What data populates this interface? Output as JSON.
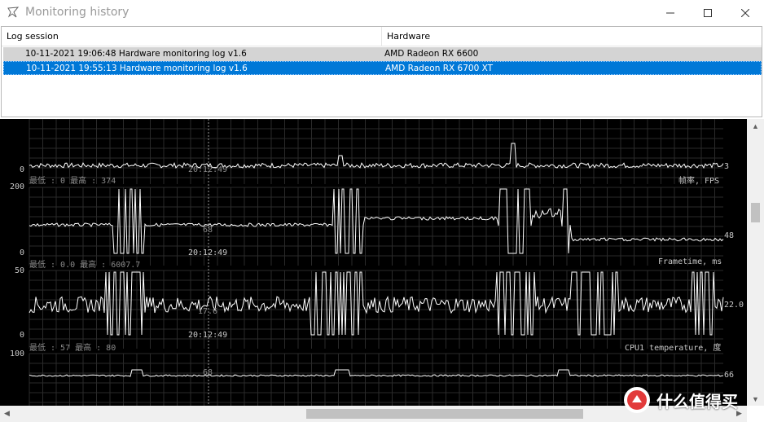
{
  "window": {
    "title": "Monitoring history",
    "icons": {
      "app": "afterburner-plane-icon",
      "minimize": "minimize-icon",
      "maximize": "maximize-icon",
      "close": "close-icon"
    }
  },
  "listview": {
    "columns": [
      "Log session",
      "Hardware"
    ],
    "rows": [
      {
        "session": "10-11-2021 19:06:48 Hardware monitoring log v1.6",
        "hardware": "AMD Radeon RX 6600",
        "selected": false
      },
      {
        "session": "10-11-2021 19:55:13 Hardware monitoring log v1.6",
        "hardware": "AMD Radeon RX 6700 XT",
        "selected": true
      }
    ]
  },
  "graphs": {
    "fps": {
      "axis_min": "0",
      "cursor_time": "20:12:49",
      "stats": "最低 : 0  最高 : 374",
      "name": "帧率, FPS",
      "current": "3"
    },
    "frametime": {
      "axis_max": "200",
      "axis_min": "0",
      "cursor_value": "68",
      "cursor_time": "20:12:49",
      "stats": "最低 : 0.0  最高 : 6007.7",
      "name": "Frametime, ms",
      "current": "48"
    },
    "cpu_temp": {
      "axis_max": "50",
      "axis_min": "0",
      "cursor_value": "17.6",
      "cursor_time": "20:12:49",
      "stats": "最低 : 57  最高 : 80",
      "name": "CPU1 temperature, 度",
      "current": "22.0"
    },
    "next": {
      "axis_max": "100",
      "cursor_value": "68",
      "current": "66"
    }
  },
  "watermark": {
    "text": "什么值得买",
    "badge": "值"
  }
}
